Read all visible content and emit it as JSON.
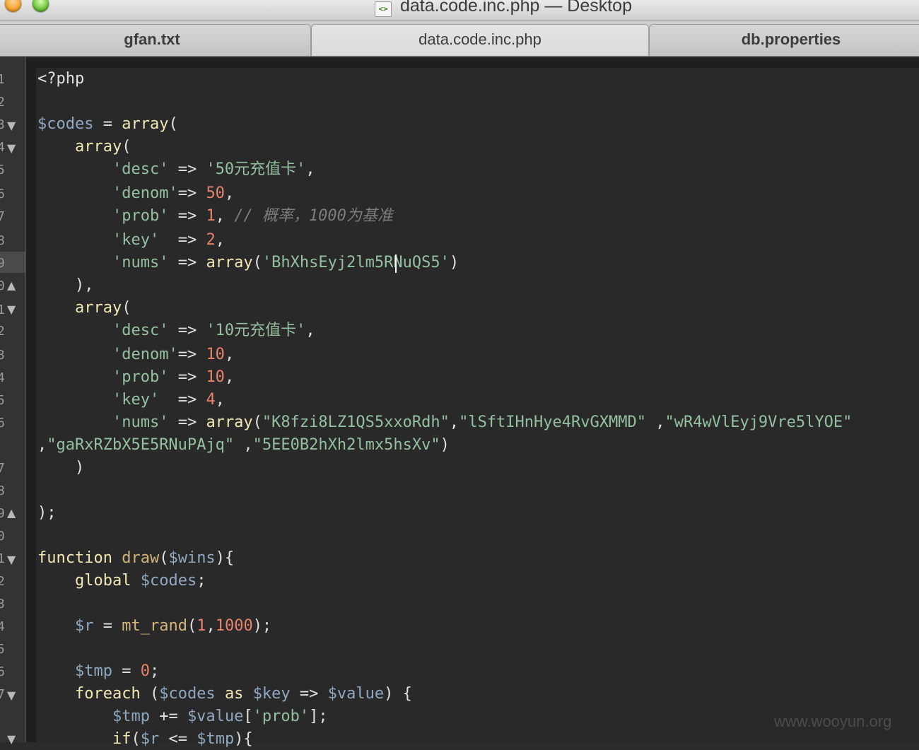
{
  "window": {
    "title": "data.code.inc.php — Desktop",
    "file_icon": "php-file-icon",
    "file_icon_glyph": "<>"
  },
  "tabs": [
    {
      "label": "gfan.txt"
    },
    {
      "label": "data.code.inc.php",
      "active": true
    },
    {
      "label": "db.properties"
    }
  ],
  "gutter": {
    "line_numbers": [
      "1",
      "2",
      "3",
      "4",
      "5",
      "6",
      "7",
      "8",
      "9",
      "0",
      "1",
      "2",
      "3",
      "4",
      "5",
      "6",
      "7",
      "8",
      "9",
      "0",
      "1",
      "2",
      "3",
      "4",
      "5",
      "6",
      "7"
    ],
    "fold_markers": {
      "collapse": "▼",
      "expand": "▲"
    }
  },
  "code_lines": [
    "<?php",
    "",
    "$codes = array(",
    "    array(",
    "        'desc' => '50元充值卡',",
    "        'denom'=> 50,",
    "        'prob' => 1, // 概率，1000为基准",
    "        'key'  => 2,",
    "        'nums' => array('BhXhsEyj2lm5RNuQS5')",
    "    ),",
    "    array(",
    "        'desc' => '10元充值卡',",
    "        'denom'=> 10,",
    "        'prob' => 10,",
    "        'key'  => 4,",
    "        'nums' => array(\"K8fzi8LZ1QS5xxoRdh\",\"lSftIHnHye4RvGXMMD\" ,\"wR4wVlEyj9Vre5lYOE\"",
    ",\"gaRxRZbX5E5RNuPAjq\" ,\"5EE0B2hXh2lmx5hsXv\")",
    "    )",
    "",
    ");",
    "",
    "function draw($wins){",
    "    global $codes;",
    "",
    "    $r = mt_rand(1,1000);",
    "",
    "    $tmp = 0;",
    "    foreach ($codes as $key => $value) {",
    "        $tmp += $value['prob'];",
    "        if($r <= $tmp){"
  ],
  "watermark": "www.wooyun.org",
  "colors": {
    "background": "#292929",
    "keyword": "#f1e6b4",
    "variable": "#8fa7bf",
    "string": "#95c0a0",
    "number": "#e7826c",
    "function": "#d2b57c",
    "comment": "#7d7d7d"
  }
}
